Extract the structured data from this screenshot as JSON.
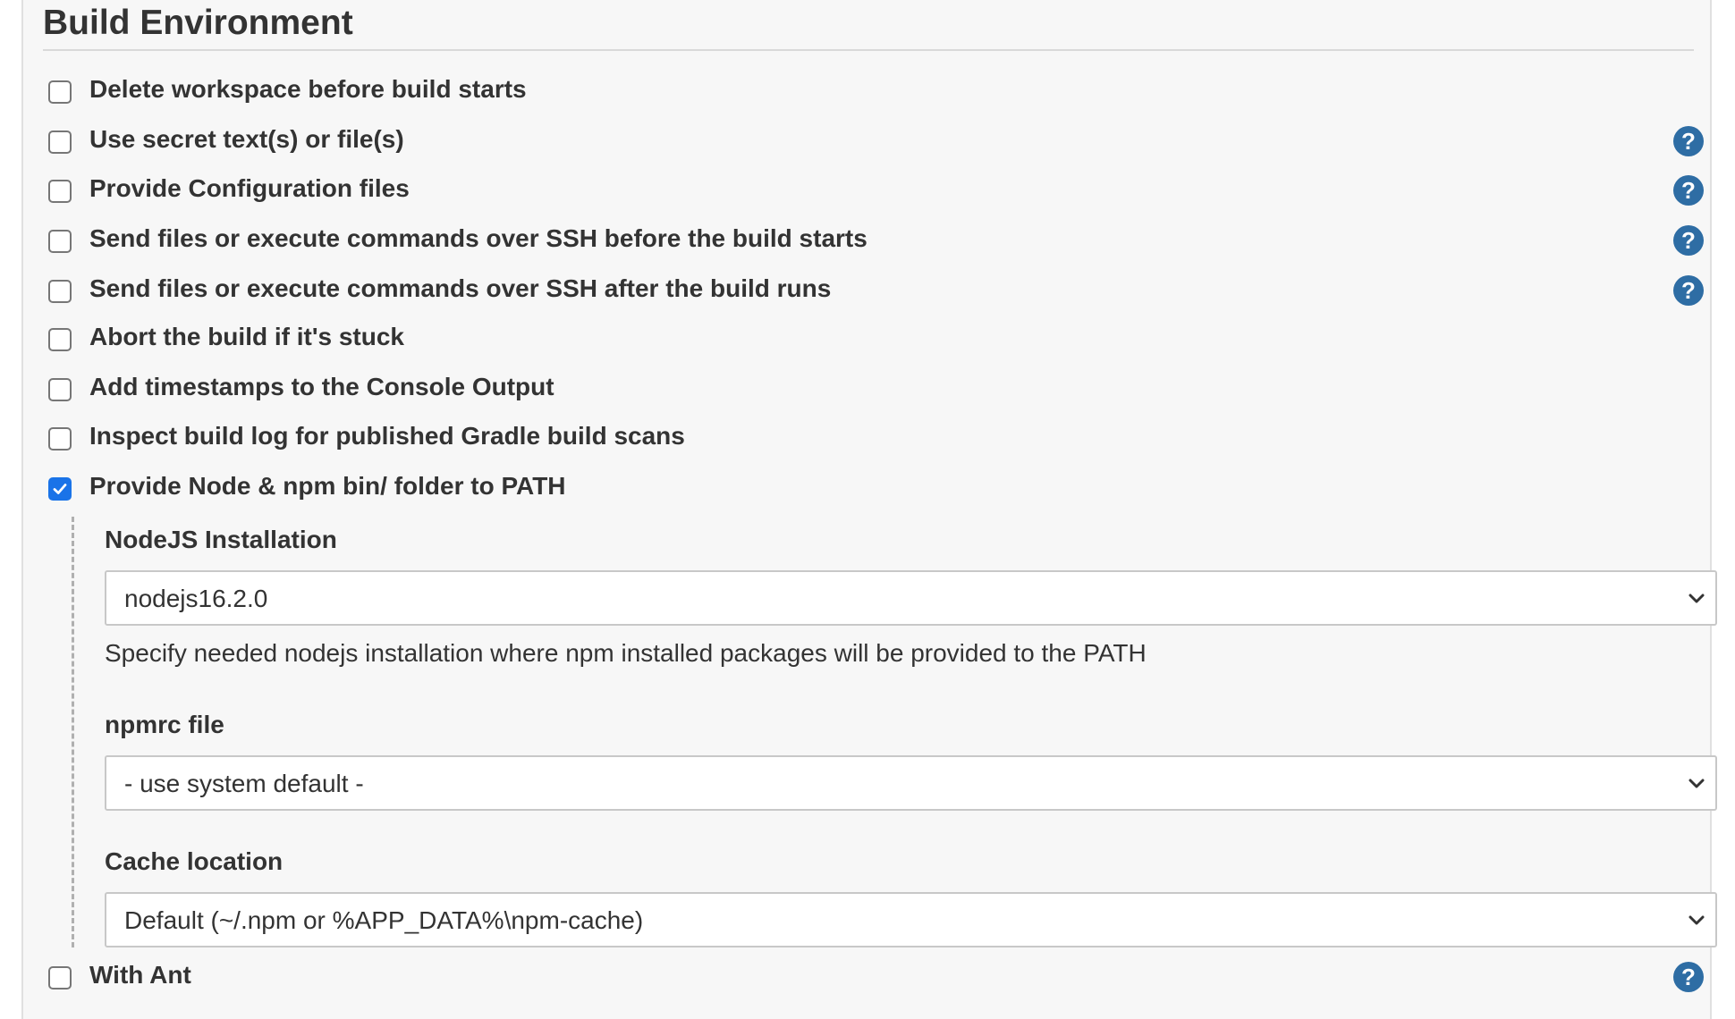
{
  "section": {
    "title": "Build Environment"
  },
  "options": [
    {
      "label": "Delete workspace before build starts",
      "checked": false,
      "has_help": false
    },
    {
      "label": "Use secret text(s) or file(s)",
      "checked": false,
      "has_help": true
    },
    {
      "label": "Provide Configuration files",
      "checked": false,
      "has_help": true
    },
    {
      "label": "Send files or execute commands over SSH before the build starts",
      "checked": false,
      "has_help": true
    },
    {
      "label": "Send files or execute commands over SSH after the build runs",
      "checked": false,
      "has_help": true
    },
    {
      "label": "Abort the build if it's stuck",
      "checked": false,
      "has_help": false
    },
    {
      "label": "Add timestamps to the Console Output",
      "checked": false,
      "has_help": false
    },
    {
      "label": "Inspect build log for published Gradle build scans",
      "checked": false,
      "has_help": false
    },
    {
      "label": "Provide Node & npm bin/ folder to PATH",
      "checked": true,
      "has_help": false
    },
    {
      "label": "With Ant",
      "checked": false,
      "has_help": true
    }
  ],
  "node_config": {
    "installation": {
      "label": "NodeJS Installation",
      "selected": "nodejs16.2.0",
      "description": "Specify needed nodejs installation where npm installed packages will be provided to the PATH"
    },
    "npmrc": {
      "label": "npmrc file",
      "selected": "- use system default -"
    },
    "cache": {
      "label": "Cache location",
      "selected": "Default (~/.npm or %APP_DATA%\\npm-cache)"
    }
  },
  "icons": {
    "help": "question-circle-icon",
    "checkmark": "checkmark-icon",
    "dropdown": "chevron-down-icon"
  },
  "colors": {
    "help_icon": "#2e6da4",
    "checkbox_checked": "#1a73e8",
    "panel_background": "#f7f7f7"
  }
}
